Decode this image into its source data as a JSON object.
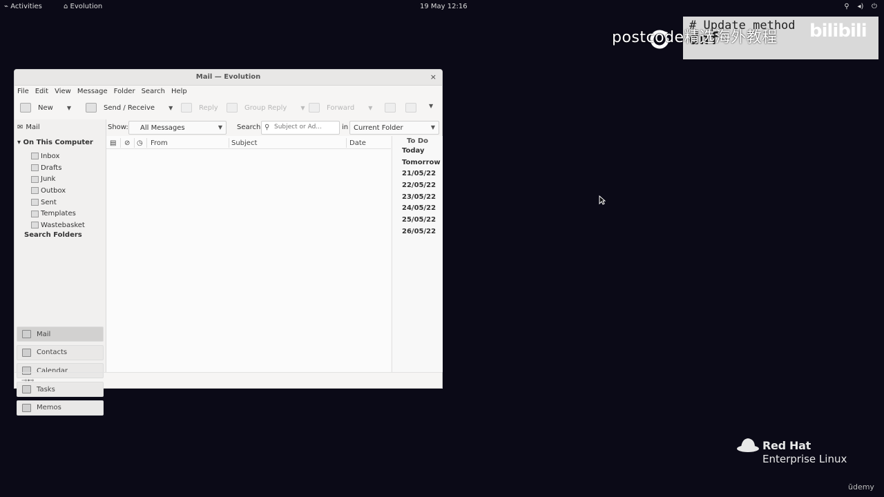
{
  "topbar": {
    "activities": "Activities",
    "app_menu": "Evolution",
    "clock": "19 May 12:16",
    "tray_icons": [
      "network-icon",
      "volume-icon",
      "power-icon"
    ]
  },
  "watermark": {
    "code_line1": "# Update method",
    "code_line2": "dnf",
    "overlay": "postcode精选海外教程",
    "brand": "bilibili"
  },
  "window": {
    "title": "Mail — Evolution",
    "close": "×",
    "menu": [
      "File",
      "Edit",
      "View",
      "Message",
      "Folder",
      "Search",
      "Help"
    ],
    "toolbar": {
      "new": "New",
      "send_receive": "Send / Receive",
      "reply": "Reply",
      "group_reply": "Group Reply",
      "forward": "Forward"
    },
    "sidebar": {
      "header": "Mail",
      "root": "On This Computer",
      "folders": [
        "Inbox",
        "Drafts",
        "Junk",
        "Outbox",
        "Sent",
        "Templates",
        "Wastebasket"
      ],
      "search_folders": "Search Folders",
      "switcher": [
        "Mail",
        "Contacts",
        "Calendar",
        "Tasks",
        "Memos"
      ]
    },
    "filter": {
      "show_label": "Show:",
      "show_value": "All Messages",
      "search_label": "Search:",
      "search_placeholder": "Subject or Ad...",
      "in_label": "in",
      "scope_value": "Current Folder"
    },
    "columns": {
      "from": "From",
      "subject": "Subject",
      "date": "Date"
    },
    "todo": {
      "title": "To Do",
      "items": [
        "Today",
        "Tomorrow",
        "21/05/22",
        "22/05/22",
        "23/05/22",
        "24/05/22",
        "25/05/22",
        "26/05/22"
      ]
    }
  },
  "branding": {
    "rh_line1": "Red Hat",
    "rh_line2": "Enterprise Linux",
    "udemy": "ūdemy"
  },
  "colors": {
    "desktop": "#0b0a17",
    "window_bg": "#f6f5f4",
    "redhat_red": "#ee0000"
  }
}
